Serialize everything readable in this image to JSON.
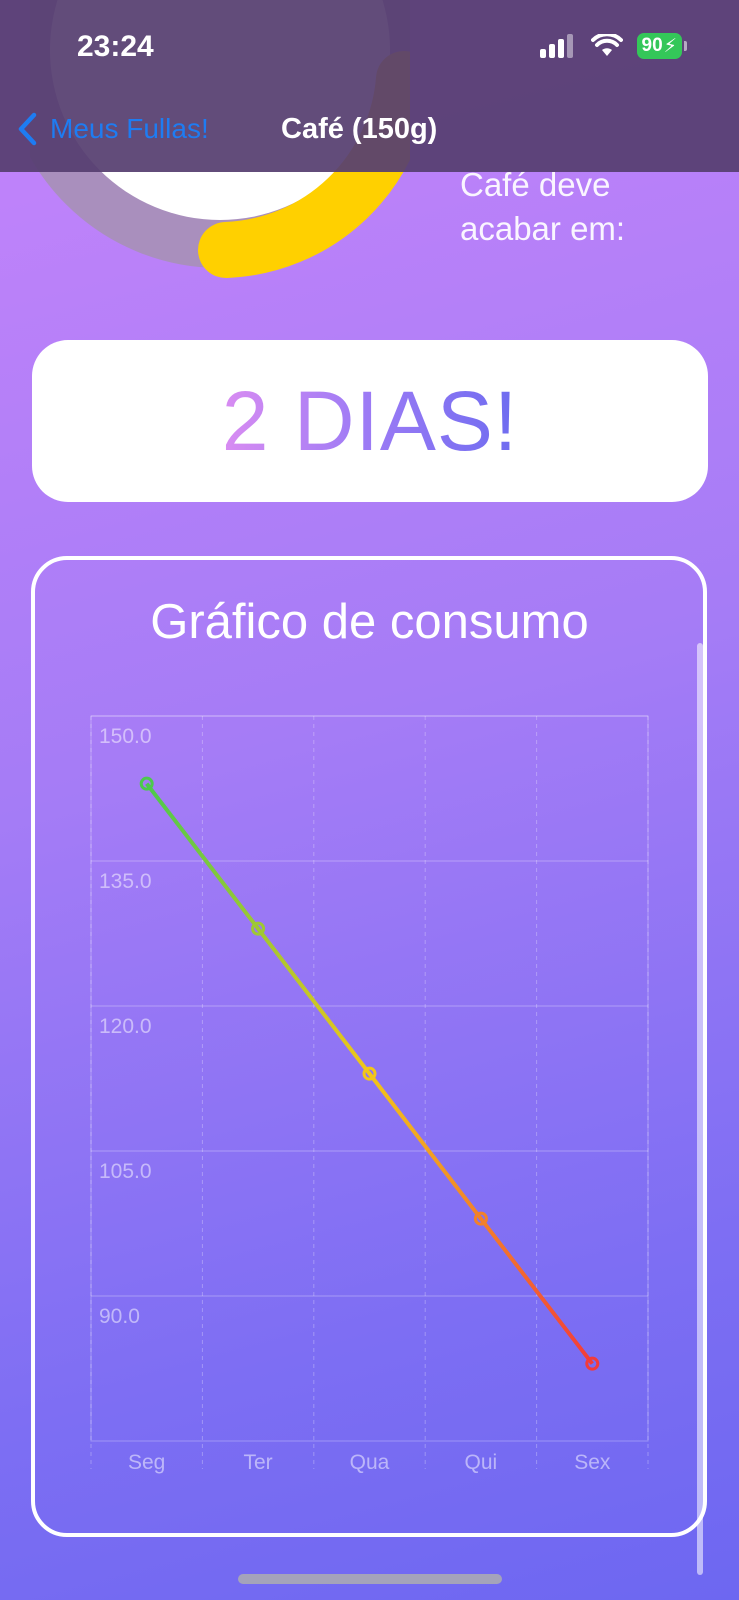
{
  "status_bar": {
    "time": "23:24",
    "battery": "90"
  },
  "nav": {
    "back_label": "Meus Fullas!",
    "title": "Café (150g)"
  },
  "summary": {
    "ending_label_line1": "Café deve",
    "ending_label_line2": "acabar em:",
    "days_left": "2 DIAS!"
  },
  "chart_section": {
    "title": "Gráfico de consumo"
  },
  "colors": {
    "ring_fill": "#ffd000",
    "ring_track": "#a98fbd",
    "line_start": "#4cc94c",
    "line_end": "#f23b3b"
  },
  "chart_data": {
    "type": "line",
    "categories": [
      "Seg",
      "Ter",
      "Qua",
      "Qui",
      "Sex"
    ],
    "values": [
      143,
      128,
      113,
      98,
      83
    ],
    "ylim": [
      75,
      150
    ],
    "yticks": [
      150,
      135,
      120,
      105,
      90
    ],
    "ytick_labels": [
      "150.0",
      "135.0",
      "120.0",
      "105.0",
      "90.0"
    ],
    "grid": true
  }
}
